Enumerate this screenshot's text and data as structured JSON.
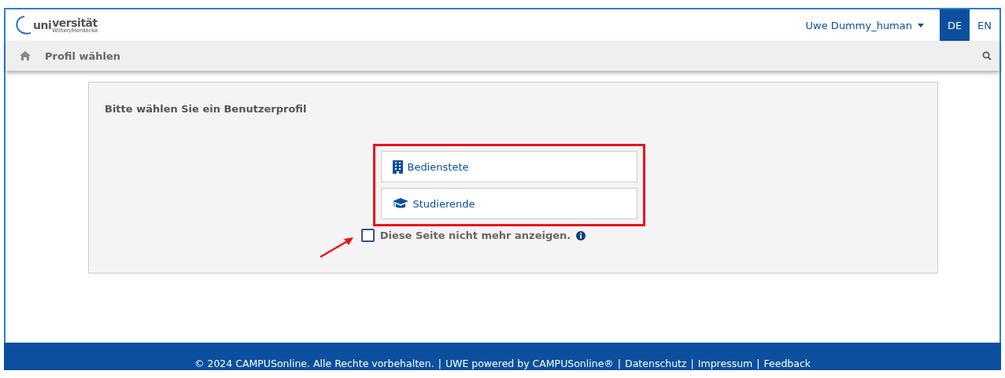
{
  "logo": {
    "part_1": "uni",
    "part_2": "versität",
    "subtitle": "Witten/Herdecke"
  },
  "user_menu": {
    "label": "Uwe Dummy_human"
  },
  "languages": [
    {
      "label": "DE",
      "selected": true
    },
    {
      "label": "EN",
      "selected": false
    }
  ],
  "nav": {
    "title": "Profil wählen"
  },
  "panel": {
    "heading": "Bitte wählen Sie ein Benutzerprofil",
    "profiles": [
      {
        "kind": "staff",
        "label": "Bedienstete"
      },
      {
        "kind": "students",
        "label": "Studierende"
      }
    ],
    "checkbox": {
      "label": "Diese Seite nicht mehr anzeigen.",
      "checked": false
    }
  },
  "footer": {
    "separator": "|",
    "copyright": "© 2024 CAMPUSonline. Alle Rechte vorbehalten.",
    "links": [
      "UWE powered by CAMPUSonline®",
      "Datenschutz",
      "Impressum",
      "Feedback"
    ]
  }
}
